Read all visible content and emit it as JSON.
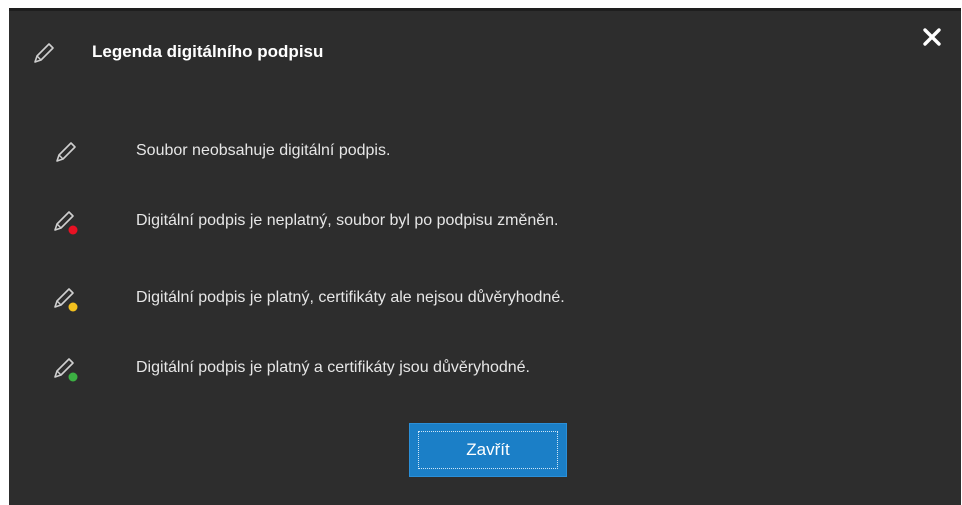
{
  "dialog": {
    "title": "Legenda digitálního podpisu",
    "title_icon": "pen-icon",
    "close_icon": "close-icon"
  },
  "legend": {
    "items": [
      {
        "icon": "pen-icon",
        "status_color": "",
        "text": "Soubor neobsahuje digitální podpis."
      },
      {
        "icon": "pen-icon",
        "status_color": "#e81123",
        "text": "Digitální podpis je neplatný, soubor byl po podpisu změněn."
      },
      {
        "icon": "pen-icon",
        "status_color": "#f2c01e",
        "text": "Digitální podpis je platný, certifikáty ale nejsou důvěryhodné."
      },
      {
        "icon": "pen-icon",
        "status_color": "#3cb043",
        "text": "Digitální podpis je platný a certifikáty jsou důvěryhodné."
      }
    ]
  },
  "footer": {
    "close_label": "Zavřít"
  }
}
